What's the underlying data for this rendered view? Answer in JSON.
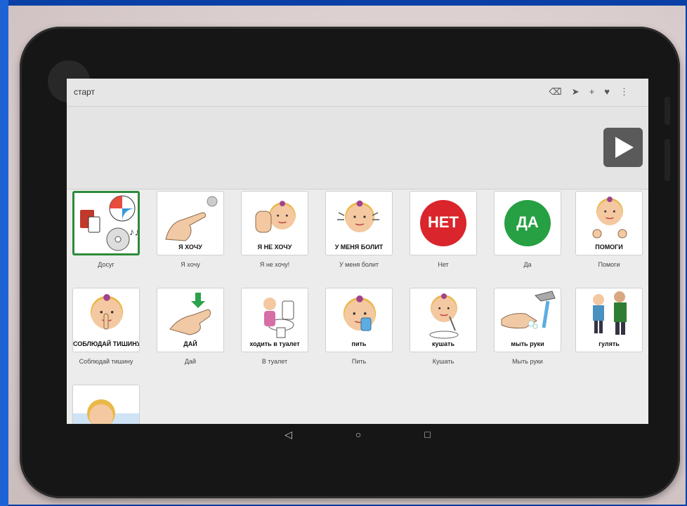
{
  "app": {
    "title": "старт"
  },
  "toolbar": {
    "icons": [
      "backspace-icon",
      "send-icon",
      "add-icon",
      "favorite-icon",
      "more-icon"
    ],
    "glyphs": {
      "backspace": "⌫",
      "send": "➤",
      "add": "+",
      "favorite": "♥",
      "more": "⋮"
    }
  },
  "tiles": [
    {
      "label": "Досуг",
      "caption": "",
      "art": "leisure",
      "selected": true
    },
    {
      "label": "Я хочу",
      "caption": "Я ХОЧУ",
      "art": "finger"
    },
    {
      "label": "Я не хочу!",
      "caption": "Я НЕ ХОЧУ",
      "art": "girl-stop"
    },
    {
      "label": "У меня болит",
      "caption": "У МЕНЯ БОЛИТ",
      "art": "girl-pain"
    },
    {
      "label": "Нет",
      "caption": "",
      "art": "circle",
      "circle_text": "НЕТ",
      "circle_color": "#d9252b"
    },
    {
      "label": "Да",
      "caption": "",
      "art": "circle",
      "circle_text": "ДА",
      "circle_color": "#26a042"
    },
    {
      "label": "Помоги",
      "caption": "ПОМОГИ",
      "art": "girl-hands"
    },
    {
      "label": "Соблюдай тишину",
      "caption": "СОБЛЮДАЙ ТИШИНУ",
      "art": "girl-quiet"
    },
    {
      "label": "Дай",
      "caption": "ДАЙ",
      "art": "hand-give"
    },
    {
      "label": "В туалет",
      "caption": "ходить в туалет",
      "art": "toilet"
    },
    {
      "label": "Пить",
      "caption": "пить",
      "art": "girl-drink"
    },
    {
      "label": "Кушать",
      "caption": "кушать",
      "art": "girl-eat"
    },
    {
      "label": "Мыть руки",
      "caption": "мыть руки",
      "art": "wash"
    },
    {
      "label": "",
      "caption": "гулять",
      "art": "walk"
    },
    {
      "label": "",
      "caption": "",
      "art": "girl-sleep"
    }
  ],
  "navbar": {
    "back": "◁",
    "home": "○",
    "recents": "□"
  },
  "colors": {
    "selected_border": "#2e8b3a",
    "play_button": "#5a5a5a"
  }
}
